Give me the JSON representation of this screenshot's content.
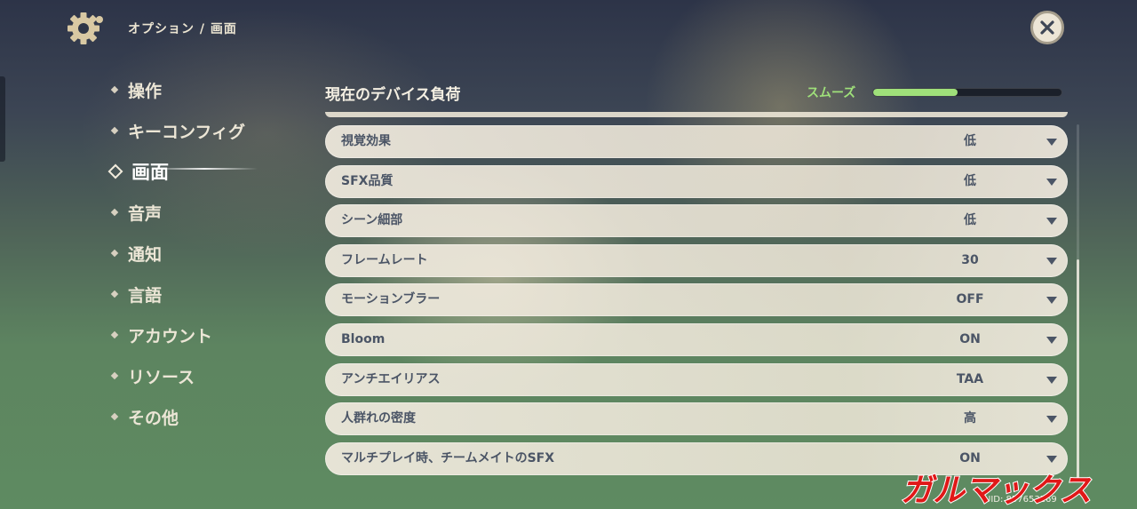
{
  "header": {
    "breadcrumb": "オプション / 画面"
  },
  "nav": {
    "items": [
      {
        "label": "操作"
      },
      {
        "label": "キーコンフィグ"
      },
      {
        "label": "画面",
        "active": true
      },
      {
        "label": "音声"
      },
      {
        "label": "通知"
      },
      {
        "label": "言語"
      },
      {
        "label": "アカウント"
      },
      {
        "label": "リソース"
      },
      {
        "label": "その他"
      }
    ]
  },
  "device_load": {
    "title": "現在のデバイス負荷",
    "status": "スムーズ",
    "level_fraction": 0.45,
    "color": "#9fe07a"
  },
  "settings": [
    {
      "label": "視覚効果",
      "value": "低"
    },
    {
      "label": "SFX品質",
      "value": "低"
    },
    {
      "label": "シーン細部",
      "value": "低"
    },
    {
      "label": "フレームレート",
      "value": "30"
    },
    {
      "label": "モーションブラー",
      "value": "OFF"
    },
    {
      "label": "Bloom",
      "value": "ON"
    },
    {
      "label": "アンチエイリアス",
      "value": "TAA"
    },
    {
      "label": "人群れの密度",
      "value": "高"
    },
    {
      "label": "マルチプレイ時、チームメイトのSFX",
      "value": "ON"
    }
  ],
  "footer": {
    "uid": "UID: 857653269",
    "watermark": "ガルマックス"
  },
  "icons": {
    "settings": "gear-icon",
    "close": "close-icon",
    "dropdown": "chevron-down-icon"
  }
}
